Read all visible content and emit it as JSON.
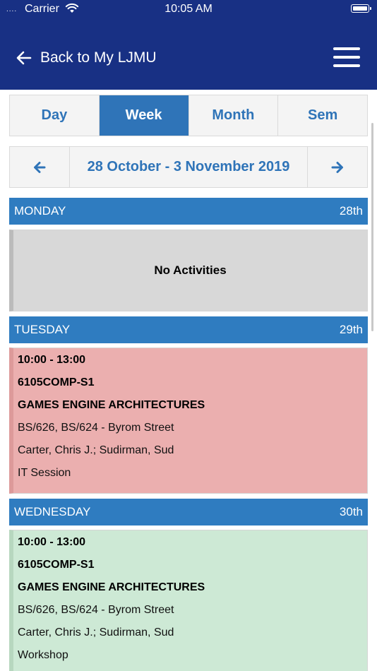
{
  "status_bar": {
    "signal": "....",
    "carrier": "Carrier",
    "time": "10:05 AM"
  },
  "nav": {
    "back_label": "Back to My LJMU"
  },
  "view_tabs": [
    {
      "label": "Day",
      "active": false
    },
    {
      "label": "Week",
      "active": true
    },
    {
      "label": "Month",
      "active": false
    },
    {
      "label": "Sem",
      "active": false
    }
  ],
  "week": {
    "range": "28 October - 3 November 2019"
  },
  "days": [
    {
      "name": "MONDAY",
      "date": "28th",
      "empty_message": "No Activities"
    },
    {
      "name": "TUESDAY",
      "date": "29th",
      "event": {
        "time": "10:00 - 13:00",
        "code": "6105COMP-S1",
        "title": "GAMES ENGINE ARCHITECTURES",
        "location": "BS/626, BS/624 - Byrom Street",
        "staff": "Carter, Chris J.; Sudirman, Sud",
        "type": "IT Session"
      }
    },
    {
      "name": "WEDNESDAY",
      "date": "30th",
      "event": {
        "time": "10:00 - 13:00",
        "code": "6105COMP-S1",
        "title": "GAMES ENGINE ARCHITECTURES",
        "location": "BS/626, BS/624 - Byrom Street",
        "staff": "Carter, Chris J.; Sudirman, Sud",
        "type": "Workshop"
      }
    }
  ],
  "colors": {
    "header_bg": "#183084",
    "accent": "#2f74b8",
    "day_header": "#2f7cc0",
    "event_it_session": "#ebafaf",
    "event_workshop": "#cde9d5",
    "empty_day": "#d8d8d8"
  },
  "icons": {
    "back": "arrow-left-icon",
    "menu": "hamburger-menu-icon",
    "prev_week": "arrow-left-icon",
    "next_week": "arrow-right-icon",
    "wifi": "wifi-icon",
    "battery": "battery-icon"
  }
}
